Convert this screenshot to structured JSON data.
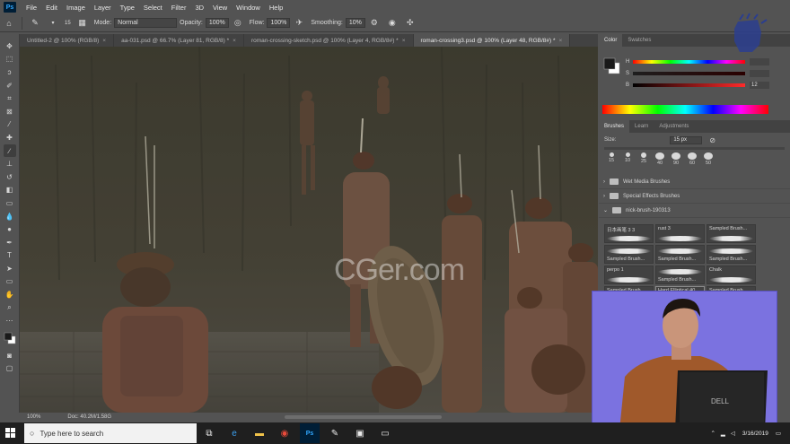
{
  "app": {
    "logo_text": "Ps"
  },
  "menu": [
    "File",
    "Edit",
    "Image",
    "Layer",
    "Type",
    "Select",
    "Filter",
    "3D",
    "View",
    "Window",
    "Help"
  ],
  "options": {
    "brush_size": "15",
    "mode_label": "Mode:",
    "mode_value": "Normal",
    "opacity_label": "Opacity:",
    "opacity_value": "100%",
    "flow_label": "Flow:",
    "flow_value": "100%",
    "smoothing_label": "Smoothing:",
    "smoothing_value": "10%"
  },
  "tabs": [
    {
      "label": "Untitled-2 @ 100% (RGB/8)",
      "active": false
    },
    {
      "label": "aa-031.psd @ 66.7% (Layer 81, RGB/8) *",
      "active": false
    },
    {
      "label": "roman-crossing-sketch.psd @ 100% (Layer 4, RGB/8#) *",
      "active": false
    },
    {
      "label": "roman-crossing3.psd @ 100% (Layer 48, RGB/8#) *",
      "active": true
    }
  ],
  "tools": [
    "move-tool",
    "marquee-tool",
    "lasso-tool",
    "quick-select-tool",
    "crop-tool",
    "frame-tool",
    "eyedropper-tool",
    "healing-tool",
    "brush-tool",
    "stamp-tool",
    "history-brush-tool",
    "eraser-tool",
    "gradient-tool",
    "blur-tool",
    "dodge-tool",
    "pen-tool",
    "type-tool",
    "path-select-tool",
    "shape-tool",
    "hand-tool",
    "zoom-tool"
  ],
  "status": {
    "zoom": "100%",
    "doc": "Doc: 40.2M/1.58G"
  },
  "color_panel": {
    "tabs": [
      "Color",
      "Swatches"
    ],
    "h_label": "H",
    "h_value": "",
    "s_label": "S",
    "s_value": "",
    "b_label": "B",
    "b_value": "12"
  },
  "brushes_panel": {
    "tabs": [
      "Brushes",
      "Learn",
      "Adjustments"
    ],
    "size_label": "Size:",
    "size_value": "15 px",
    "tips": [
      "15",
      "10",
      "25",
      "40",
      "90",
      "60",
      "50"
    ],
    "folders": [
      "Wet Media Brushes",
      "Special Effects Brushes",
      "nick-brush-190313"
    ],
    "brushes": [
      {
        "name": "日本画笔 3 3"
      },
      {
        "name": "rust 3"
      },
      {
        "name": "Sampled Brush..."
      },
      {
        "name": "Sampled Brush..."
      },
      {
        "name": "Sampled Brush..."
      },
      {
        "name": "Sampled Brush..."
      },
      {
        "name": "perpo 1"
      },
      {
        "name": "Sampled Brush..."
      },
      {
        "name": "Chalk"
      },
      {
        "name": "Sampled Brush..."
      },
      {
        "name": "Hard Elliptical 40..."
      },
      {
        "name": "Sampled Brush..."
      }
    ]
  },
  "watermark": "CGer.com",
  "taskbar": {
    "search_placeholder": "Type here to search",
    "time": "",
    "date": "3/16/2019",
    "apps": [
      "task-view",
      "edge",
      "file-explorer",
      "chrome",
      "photoshop",
      "app-1",
      "photos",
      "app-2"
    ]
  },
  "colors": {
    "ui_bg": "#535353",
    "panel_dark": "#424242",
    "webcam_bg": "#7b72e0",
    "taskbar": "#1f1f1f"
  }
}
